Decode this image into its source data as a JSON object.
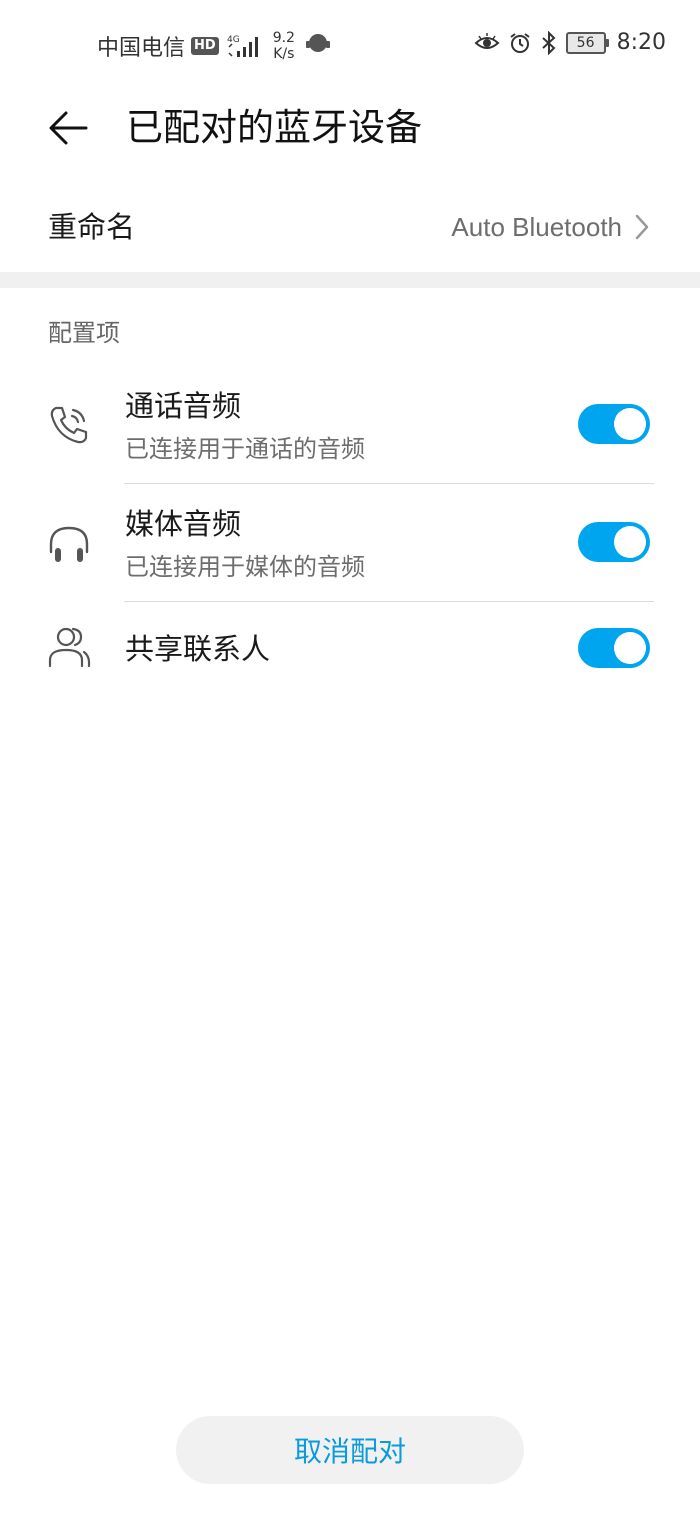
{
  "status_bar": {
    "carrier": "中国电信",
    "hd_badge": "HD",
    "network_type": "4G",
    "speed_value": "9.2",
    "speed_unit": "K/s",
    "battery": "56",
    "time": "8:20",
    "icons": [
      "signal-icon",
      "vpn-icon",
      "eye-icon",
      "alarm-icon",
      "bluetooth-icon",
      "battery-icon"
    ]
  },
  "header": {
    "title": "已配对的蓝牙设备",
    "back_icon": "back-arrow-icon"
  },
  "rename": {
    "label": "重命名",
    "value": "Auto Bluetooth",
    "chevron_icon": "chevron-right-icon"
  },
  "section": {
    "header": "配置项",
    "items": [
      {
        "title": "通话音频",
        "subtitle": "已连接用于通话的音频",
        "icon": "phone-call-icon",
        "enabled": true
      },
      {
        "title": "媒体音频",
        "subtitle": "已连接用于媒体的音频",
        "icon": "headphones-icon",
        "enabled": true
      },
      {
        "title": "共享联系人",
        "subtitle": "",
        "icon": "contacts-icon",
        "enabled": true
      }
    ]
  },
  "footer": {
    "unpair_label": "取消配对"
  },
  "colors": {
    "accent": "#00a5ef",
    "unpair_text": "#0a9bdc",
    "band": "#f0f0f0"
  }
}
